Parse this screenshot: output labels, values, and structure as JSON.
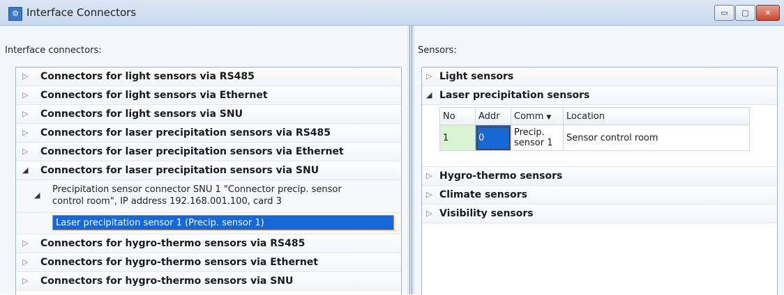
{
  "window": {
    "title": "Interface Connectors",
    "buttons": {
      "minimize": "▭",
      "maximize": "▢",
      "close": "✕"
    }
  },
  "left": {
    "label": "Interface connectors:",
    "groups_before": [
      "Connectors for light sensors via RS485",
      "Connectors for light sensors via Ethernet",
      "Connectors for light sensors via SNU",
      "Connectors for laser precipitation sensors via RS485",
      "Connectors for laser precipitation sensors via Ethernet"
    ],
    "expanded_group": "Connectors for laser precipitation sensors via SNU",
    "connector": {
      "line1": "Precipitation sensor connector SNU 1 \"Connector precip. sensor",
      "line2": "control room\", IP address 192.168.001.100, card 3"
    },
    "selected_sensor": "Laser precipitation sensor 1 (Precip. sensor 1)",
    "groups_after": [
      "Connectors for hygro-thermo sensors via RS485",
      "Connectors for hygro-thermo sensors via Ethernet",
      "Connectors for hygro-thermo sensors via SNU"
    ]
  },
  "right": {
    "label": "Sensors:",
    "group_light": "Light sensors",
    "group_laser": "Laser precipitation sensors",
    "grid": {
      "headers": [
        "No",
        "Addr",
        "Comm",
        "Location"
      ],
      "row": {
        "no": "1",
        "addr": "0",
        "comm_line1": "Precip.",
        "comm_line2": "sensor 1",
        "location": "Sensor control room"
      }
    },
    "groups_after": [
      "Hygro-thermo sensors",
      "Climate sensors",
      "Visibility sensors"
    ]
  },
  "icons": {
    "collapsed": "▷",
    "expanded": "◢"
  }
}
